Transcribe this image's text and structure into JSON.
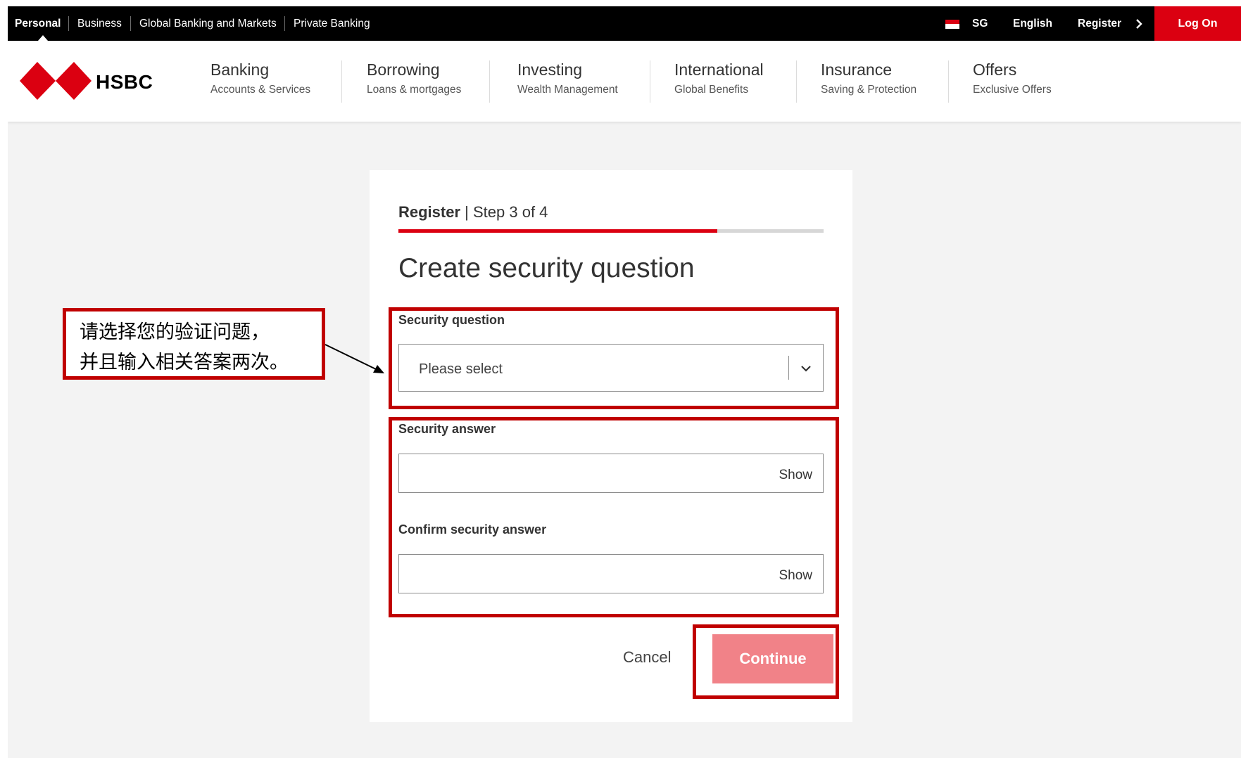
{
  "topbar": {
    "segments": [
      "Personal",
      "Business",
      "Global Banking and Markets",
      "Private Banking"
    ],
    "region": "SG",
    "language": "English",
    "register": "Register",
    "logon": "Log On"
  },
  "brand": {
    "name": "HSBC"
  },
  "nav": [
    {
      "title": "Banking",
      "sub": "Accounts & Services"
    },
    {
      "title": "Borrowing",
      "sub": "Loans & mortgages"
    },
    {
      "title": "Investing",
      "sub": "Wealth Management"
    },
    {
      "title": "International",
      "sub": "Global Benefits"
    },
    {
      "title": "Insurance",
      "sub": "Saving & Protection"
    },
    {
      "title": "Offers",
      "sub": "Exclusive Offers"
    }
  ],
  "form": {
    "step_label": "Register",
    "step_text": " | Step 3 of 4",
    "progress": 0.75,
    "heading": "Create security question",
    "question_label": "Security question",
    "question_value": "Please select",
    "answer_label": "Security answer",
    "answer_show": "Show",
    "confirm_label": "Confirm security answer",
    "confirm_show": "Show",
    "cancel": "Cancel",
    "continue": "Continue"
  },
  "annotation": {
    "line1": "请选择您的验证问题，",
    "line2": "并且输入相关答案两次。"
  },
  "colors": {
    "brand_red": "#db0011",
    "annotation_red": "#c00000",
    "continue_disabled": "#f18288"
  }
}
